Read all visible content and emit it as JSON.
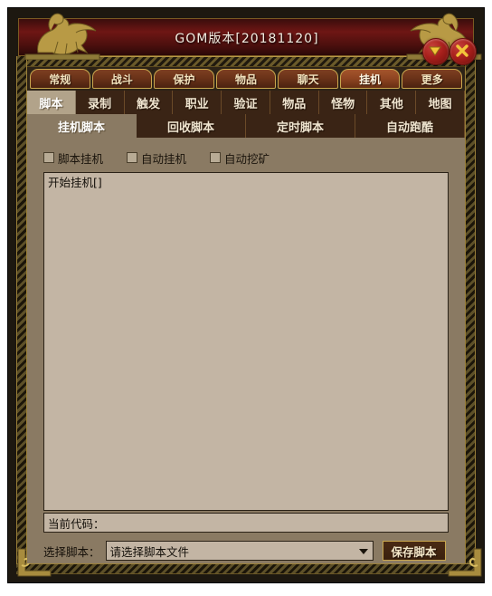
{
  "window": {
    "title": "GOM版本[20181120]",
    "minimize_icon": "triangle-down-icon",
    "close_icon": "close-x-icon",
    "accent_gold": "#c8a64e",
    "accent_red": "#6e1614",
    "panel_bg": "#8a7a63",
    "field_bg": "#c3b5a4",
    "tab_bg": "#3a2415"
  },
  "tabs_primary": {
    "active_index": 5,
    "items": [
      {
        "label": "常规"
      },
      {
        "label": "战斗"
      },
      {
        "label": "保护"
      },
      {
        "label": "物品"
      },
      {
        "label": "聊天"
      },
      {
        "label": "挂机"
      },
      {
        "label": "更多"
      }
    ]
  },
  "tabs_secondary": {
    "active_index": 0,
    "items": [
      {
        "label": "脚本"
      },
      {
        "label": "录制"
      },
      {
        "label": "触发"
      },
      {
        "label": "职业"
      },
      {
        "label": "验证"
      },
      {
        "label": "物品"
      },
      {
        "label": "怪物"
      },
      {
        "label": "其他"
      },
      {
        "label": "地图"
      }
    ]
  },
  "tabs_tertiary": {
    "active_index": 0,
    "items": [
      {
        "label": "挂机脚本"
      },
      {
        "label": "回收脚本"
      },
      {
        "label": "定时脚本"
      },
      {
        "label": "自动跑酷"
      }
    ]
  },
  "options": {
    "checkboxes": [
      {
        "label": "脚本挂机",
        "checked": false
      },
      {
        "label": "自动挂机",
        "checked": false
      },
      {
        "label": "自动挖矿",
        "checked": false
      }
    ]
  },
  "script_editor": {
    "content": "开始挂机[]"
  },
  "current_code": {
    "label": "当前代码："
  },
  "script_select": {
    "label": "选择脚本：",
    "value": "请选择脚本文件",
    "arrow_icon": "chevron-down-icon"
  },
  "actions": {
    "save_label": "保存脚本"
  }
}
